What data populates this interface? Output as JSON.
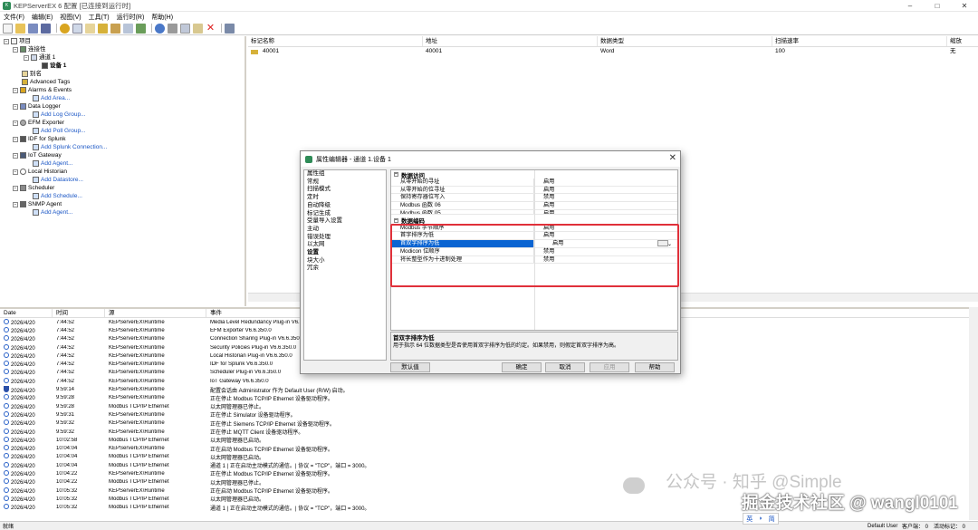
{
  "window": {
    "title": "KEPServerEX 6 配置 [已连接到运行时]",
    "min": "–",
    "max": "□",
    "close": "✕"
  },
  "menu": [
    "文件(F)",
    "编辑(E)",
    "视图(V)",
    "工具(T)",
    "运行时(R)",
    "帮助(H)"
  ],
  "tree": {
    "project": "项目",
    "connectivity": "连接性",
    "channel": "通道 1",
    "device": "设备 1",
    "aliases": "别名",
    "advanced_tags": "Advanced Tags",
    "alarms": "Alarms & Events",
    "add_area": "Add Area...",
    "data_logger": "Data Logger",
    "add_log_group": "Add Log Group...",
    "efm": "EFM Exporter",
    "add_poll_group": "Add Poll Group...",
    "splunk": "IDF for Splunk",
    "add_splunk": "Add Splunk Connection...",
    "iot": "IoT Gateway",
    "add_agent": "Add Agent...",
    "historian": "Local Historian",
    "add_datastore": "Add Datastore...",
    "scheduler": "Scheduler",
    "add_schedule": "Add Schedule...",
    "snmp": "SNMP Agent",
    "add_agent2": "Add Agent..."
  },
  "tags": {
    "columns": [
      "标记名称",
      "地址",
      "数据类型",
      "扫描速率",
      "缩放"
    ],
    "rows": [
      {
        "name": "40001",
        "address": "40001",
        "type": "Word",
        "rate": "100",
        "scale": "无"
      }
    ]
  },
  "log": {
    "columns": [
      "Date",
      "时间",
      "源",
      "事件"
    ],
    "rows": [
      {
        "date": "2026/4/20",
        "time": "7:44:52",
        "src": "KEPServerEX\\Runtime",
        "evt": "Media Level Redundancy Plug-in V6.6.350.0"
      },
      {
        "date": "2026/4/20",
        "time": "7:44:52",
        "src": "KEPServerEX\\Runtime",
        "evt": "EFM Exporter V6.6.350.0"
      },
      {
        "date": "2026/4/20",
        "time": "7:44:52",
        "src": "KEPServerEX\\Runtime",
        "evt": "Connection Sharing Plug-in V6.6.350.0"
      },
      {
        "date": "2026/4/20",
        "time": "7:44:52",
        "src": "KEPServerEX\\Runtime",
        "evt": "Security Policies Plug-in V6.6.350.0"
      },
      {
        "date": "2026/4/20",
        "time": "7:44:52",
        "src": "KEPServerEX\\Runtime",
        "evt": "Local Historian Plug-in V6.6.350.0"
      },
      {
        "date": "2026/4/20",
        "time": "7:44:52",
        "src": "KEPServerEX\\Runtime",
        "evt": "IDF for Splunk V6.6.350.0"
      },
      {
        "date": "2026/4/20",
        "time": "7:44:52",
        "src": "KEPServerEX\\Runtime",
        "evt": "Scheduler Plug-in V6.6.350.0"
      },
      {
        "date": "2026/4/20",
        "time": "7:44:52",
        "src": "KEPServerEX\\Runtime",
        "evt": "IoT Gateway V6.6.350.0"
      },
      {
        "date": "2026/4/20",
        "time": "9:59:14",
        "src": "KEPServerEX\\Runtime",
        "evt": "配置会话由 Administrator 作为 Default User (R/W) 启动。"
      },
      {
        "date": "2026/4/20",
        "time": "9:59:28",
        "src": "KEPServerEX\\Runtime",
        "evt": "正在停止 Modbus TCP/IP Ethernet 设备驱动程序。"
      },
      {
        "date": "2026/4/20",
        "time": "9:59:28",
        "src": "Modbus TCP/IP Ethernet",
        "evt": "以太网管理器已停止。"
      },
      {
        "date": "2026/4/20",
        "time": "9:59:31",
        "src": "KEPServerEX\\Runtime",
        "evt": "正在停止 Simulator 设备驱动程序。"
      },
      {
        "date": "2026/4/20",
        "time": "9:59:32",
        "src": "KEPServerEX\\Runtime",
        "evt": "正在停止 Siemens TCP/IP Ethernet 设备驱动程序。"
      },
      {
        "date": "2026/4/20",
        "time": "9:59:32",
        "src": "KEPServerEX\\Runtime",
        "evt": "正在停止 MQTT Client 设备驱动程序。"
      },
      {
        "date": "2026/4/20",
        "time": "10:02:58",
        "src": "Modbus TCP/IP Ethernet",
        "evt": "以太网管理器已启动。"
      },
      {
        "date": "2026/4/20",
        "time": "10:04:04",
        "src": "KEPServerEX\\Runtime",
        "evt": "正在启动 Modbus TCP/IP Ethernet 设备驱动程序。"
      },
      {
        "date": "2026/4/20",
        "time": "10:04:04",
        "src": "Modbus TCP/IP Ethernet",
        "evt": "以太网管理器已启动。"
      },
      {
        "date": "2026/4/20",
        "time": "10:04:04",
        "src": "Modbus TCP/IP Ethernet",
        "evt": "通道 1 | 正在启动主动模式的通信。| 协议 = \"TCP\"，端口 = 3000。"
      },
      {
        "date": "2026/4/20",
        "time": "10:04:22",
        "src": "KEPServerEX\\Runtime",
        "evt": "正在停止 Modbus TCP/IP Ethernet 设备驱动程序。"
      },
      {
        "date": "2026/4/20",
        "time": "10:04:22",
        "src": "Modbus TCP/IP Ethernet",
        "evt": "以太网管理器已停止。"
      },
      {
        "date": "2026/4/20",
        "time": "10:05:32",
        "src": "KEPServerEX\\Runtime",
        "evt": "正在启动 Modbus TCP/IP Ethernet 设备驱动程序。"
      },
      {
        "date": "2026/4/20",
        "time": "10:05:32",
        "src": "Modbus TCP/IP Ethernet",
        "evt": "以太网管理器已启动。"
      },
      {
        "date": "2026/4/20",
        "time": "10:05:32",
        "src": "Modbus TCP/IP Ethernet",
        "evt": "通道 1 | 正在启动主动模式的通信。| 协议 = \"TCP\"，端口 = 3000。"
      }
    ]
  },
  "dialog": {
    "title": "属性编辑器 - 通道 1.设备 1",
    "close": "✕",
    "groups": [
      "属性组",
      "常规",
      "扫描模式",
      "定时",
      "自动降级",
      "标记生成",
      "受量导入设置",
      "主动",
      "错误处理",
      "以太网",
      "设置",
      "块大小",
      "冗余"
    ],
    "sec_access": "数据访问",
    "access_rows": [
      {
        "k": "从零开始的寻址",
        "v": "启用"
      },
      {
        "k": "从零开始的位寻址",
        "v": "启用"
      },
      {
        "k": "保持寄存器位写入",
        "v": "禁用"
      },
      {
        "k": "Modbus 函数 06",
        "v": "启用"
      },
      {
        "k": "Modbus 函数 05",
        "v": "启用"
      }
    ],
    "sec_encoding": "数据编码",
    "encoding_rows": [
      {
        "k": "Modbus 字节顺序",
        "v": "启用"
      },
      {
        "k": "首字排序为低",
        "v": "启用"
      },
      {
        "k": "首双字排序为低",
        "v": "启用"
      },
      {
        "k": "Modicon 位顺序",
        "v": "禁用"
      },
      {
        "k": "将长整型作为十进制处理",
        "v": "禁用"
      }
    ],
    "desc_title": "首双字排序为低",
    "desc_text": "用于指示 64 位数据类型是否使用首双字排序为低的约定。如果禁用，则假定首双字排序为高。",
    "btn_default": "默认值",
    "btn_ok": "确定",
    "btn_cancel": "取消",
    "btn_apply": "应用",
    "btn_help": "帮助"
  },
  "status": {
    "left": "就绪",
    "user": "Default User",
    "clients": "客户端： 0",
    "active": "活动标记： 0"
  },
  "watermark": {
    "line1": "公众号 · 知乎 @Simple",
    "line2": "掘金技术社区 @ wangl0101"
  },
  "ime": {
    "a": "英",
    "b": "◗",
    "c": "简"
  },
  "colors": {
    "highlight": "#0a64d2",
    "redbox": "#e0303a",
    "link": "#1a56c5"
  }
}
